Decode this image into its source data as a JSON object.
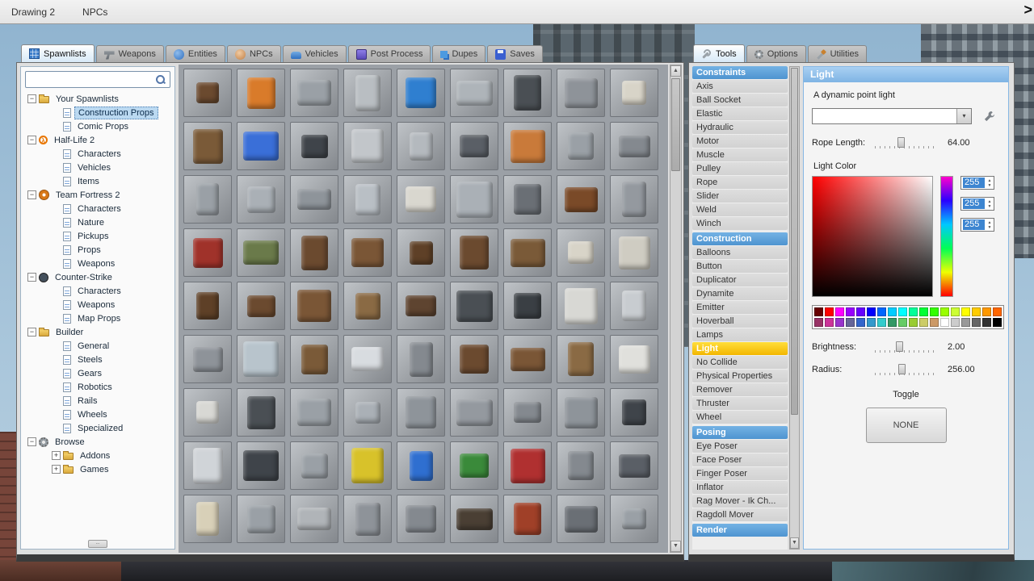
{
  "menubar": {
    "items": [
      "Drawing 2",
      "NPCs"
    ]
  },
  "spawnmenu": {
    "active_tab": 0,
    "tabs": [
      {
        "label": "Spawnlists",
        "icon": "grid"
      },
      {
        "label": "Weapons",
        "icon": "gun"
      },
      {
        "label": "Entities",
        "icon": "plug"
      },
      {
        "label": "NPCs",
        "icon": "npc"
      },
      {
        "label": "Vehicles",
        "icon": "car"
      },
      {
        "label": "Post Process",
        "icon": "monitor"
      },
      {
        "label": "Dupes",
        "icon": "dupes"
      },
      {
        "label": "Saves",
        "icon": "disk"
      }
    ],
    "search": {
      "value": "",
      "placeholder": ""
    },
    "tree": [
      {
        "label": "Your Spawnlists",
        "icon": "folder",
        "expander": "minus",
        "level": 0
      },
      {
        "label": "Construction Props",
        "icon": "page",
        "level": 1,
        "selected": true
      },
      {
        "label": "Comic Props",
        "icon": "page",
        "level": 1
      },
      {
        "label": "Half-Life 2",
        "icon": "hl2",
        "expander": "minus",
        "level": 0
      },
      {
        "label": "Characters",
        "icon": "page",
        "level": 1
      },
      {
        "label": "Vehicles",
        "icon": "page",
        "level": 1
      },
      {
        "label": "Items",
        "icon": "page",
        "level": 1
      },
      {
        "label": "Team Fortress 2",
        "icon": "tf2",
        "expander": "minus",
        "level": 0
      },
      {
        "label": "Characters",
        "icon": "page",
        "level": 1
      },
      {
        "label": "Nature",
        "icon": "page",
        "level": 1
      },
      {
        "label": "Pickups",
        "icon": "page",
        "level": 1
      },
      {
        "label": "Props",
        "icon": "page",
        "level": 1
      },
      {
        "label": "Weapons",
        "icon": "page",
        "level": 1
      },
      {
        "label": "Counter-Strike",
        "icon": "cs",
        "expander": "minus",
        "level": 0
      },
      {
        "label": "Characters",
        "icon": "page",
        "level": 1
      },
      {
        "label": "Weapons",
        "icon": "page",
        "level": 1
      },
      {
        "label": "Map Props",
        "icon": "page",
        "level": 1
      },
      {
        "label": "Builder",
        "icon": "folder",
        "expander": "minus",
        "level": 0
      },
      {
        "label": "General",
        "icon": "page",
        "level": 1
      },
      {
        "label": "Steels",
        "icon": "page",
        "level": 1
      },
      {
        "label": "Gears",
        "icon": "page",
        "level": 1
      },
      {
        "label": "Robotics",
        "icon": "page",
        "level": 1
      },
      {
        "label": "Rails",
        "icon": "page",
        "level": 1
      },
      {
        "label": "Wheels",
        "icon": "page",
        "level": 1
      },
      {
        "label": "Specialized",
        "icon": "page",
        "level": 1
      },
      {
        "label": "Browse",
        "icon": "gear",
        "expander": "minus",
        "level": 0
      },
      {
        "label": "Addons",
        "icon": "folder",
        "expander": "plus",
        "level": 1
      },
      {
        "label": "Games",
        "icon": "folder",
        "expander": "plus",
        "level": 1
      }
    ],
    "grid": {
      "rows": [
        [
          "#6b4a2f",
          "#d97b2a",
          "#9aa0a6",
          "#b9bec2",
          "#2f7fd0",
          "#aeb4b9",
          "#4a4f54",
          "#8e9399",
          "#d8d4c8"
        ],
        [
          "#7a5a38",
          "#3a6fd8",
          "#3f444a",
          "#c2c6ca",
          "#b4b9be",
          "#5a5f66",
          "#c97a3a",
          "#9aa0a6",
          "#84898f"
        ],
        [
          "#9aa0a6",
          "#aab0b6",
          "#8e949a",
          "#b9bfc5",
          "#d9d7cf",
          "#aab0b6",
          "#6a6f75",
          "#7a4a28",
          "#94999f"
        ],
        [
          "#a0322a",
          "#6a7a4a",
          "#6b4a2f",
          "#7a5636",
          "#5e4027",
          "#6b4a2f",
          "#7a5a38",
          "#d8d4c8",
          "#cfccc2"
        ],
        [
          "#5e4027",
          "#6b4a2f",
          "#7a5636",
          "#8a6a44",
          "#5e4430",
          "#4a4f54",
          "#3a3f44",
          "#d8d8d4",
          "#c8ccd0"
        ],
        [
          "#8e9399",
          "#b8c4cc",
          "#7a5a38",
          "#d8dce0",
          "#84898f",
          "#6b4a2f",
          "#7a5636",
          "#8a6a44",
          "#e0e0dc"
        ],
        [
          "#d8d8d4",
          "#4a4f54",
          "#9aa0a6",
          "#aab0b6",
          "#8e949a",
          "#94999f",
          "#84898f",
          "#8e949a",
          "#3f444a"
        ],
        [
          "#d0d4d8",
          "#3f444a",
          "#9aa0a6",
          "#d8c22a",
          "#2f6fd0",
          "#3a8a3a",
          "#b03030",
          "#84898f",
          "#5a5f66"
        ],
        [
          "#d8d0b8",
          "#9aa0a6",
          "#b0b4b8",
          "#8e9399",
          "#84898f",
          "#4a3f34",
          "#a04028",
          "#6a6f75",
          "#9aa0a6"
        ]
      ]
    }
  },
  "toolmenu": {
    "active_tab": 0,
    "tabs": [
      {
        "label": "Tools",
        "icon": "wrench"
      },
      {
        "label": "Options",
        "icon": "gear"
      },
      {
        "label": "Utilities",
        "icon": "screwdriver"
      }
    ],
    "categories": [
      {
        "name": "Constraints",
        "items": [
          "Axis",
          "Ball Socket",
          "Elastic",
          "Hydraulic",
          "Motor",
          "Muscle",
          "Pulley",
          "Rope",
          "Slider",
          "Weld",
          "Winch"
        ]
      },
      {
        "name": "Construction",
        "selected": "Light",
        "items": [
          "Balloons",
          "Button",
          "Duplicator",
          "Dynamite",
          "Emitter",
          "Hoverball",
          "Lamps",
          "Light",
          "No Collide",
          "Physical Properties",
          "Remover",
          "Thruster",
          "Wheel"
        ]
      },
      {
        "name": "Posing",
        "items": [
          "Eye Poser",
          "Face Poser",
          "Finger Poser",
          "Inflator",
          "Rag Mover - Ik Ch...",
          "Ragdoll Mover"
        ]
      },
      {
        "name": "Render",
        "items": []
      }
    ],
    "panel": {
      "title": "Light",
      "description": "A dynamic point light",
      "combo_value": "",
      "rope_length": {
        "label": "Rope Length:",
        "value": "64.00",
        "fraction": 0.42
      },
      "light_color_label": "Light Color",
      "rgb": [
        "255",
        "255",
        "255"
      ],
      "picker": {
        "square_hue": "#ff0000",
        "hue_top_to_bottom": [
          "#ff00cc",
          "#2a00ff",
          "#00c8ff",
          "#00ff55",
          "#eeff00",
          "#ff0000"
        ]
      },
      "palette": {
        "rows": [
          [
            "#660000",
            "#ff0000",
            "#ff00ff",
            "#9900ff",
            "#6600ff",
            "#0000ff",
            "#0066ff",
            "#00ccff",
            "#00ffff",
            "#00ff99",
            "#00ff33",
            "#33ff00",
            "#99ff00",
            "#ccff33",
            "#ffff00",
            "#ffcc00",
            "#ff9900",
            "#ff6600"
          ],
          [
            "#993366",
            "#cc3399",
            "#9933cc",
            "#666699",
            "#3366cc",
            "#3399cc",
            "#33cccc",
            "#339966",
            "#66cc66",
            "#99cc33",
            "#cccc66",
            "#cc9966",
            "#ffffff",
            "#cccccc",
            "#999999",
            "#666666",
            "#333333",
            "#000000"
          ]
        ]
      },
      "brightness": {
        "label": "Brightness:",
        "value": "2.00",
        "fraction": 0.4
      },
      "radius": {
        "label": "Radius:",
        "value": "256.00",
        "fraction": 0.44
      },
      "toggle_label": "Toggle",
      "toggle_button": "NONE"
    }
  }
}
